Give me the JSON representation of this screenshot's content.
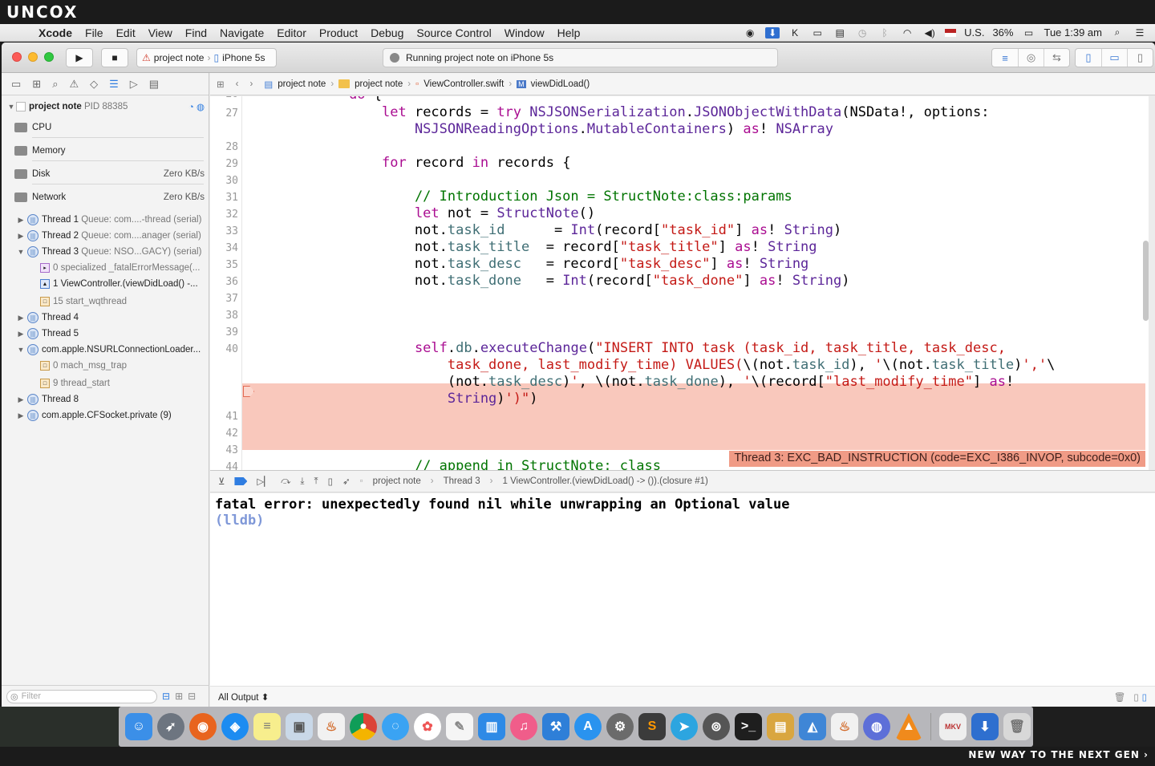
{
  "watermark": "UNCOX",
  "bottom_tag": "NEW WAY TO THE NEXT GEN ›",
  "menubar": {
    "app": "Xcode",
    "items": [
      "File",
      "Edit",
      "View",
      "Find",
      "Navigate",
      "Editor",
      "Product",
      "Debug",
      "Source Control",
      "Window",
      "Help"
    ],
    "input_source": "U.S.",
    "battery": "36%",
    "clock": "Tue 1:39 am"
  },
  "toolbar": {
    "scheme_project": "project note",
    "scheme_device": "iPhone 5s",
    "activity": "Running project note on iPhone 5s"
  },
  "navigator": {
    "process_name": "project note",
    "process_pid": "PID 88385",
    "gauges": [
      {
        "label": "CPU",
        "value": ""
      },
      {
        "label": "Memory",
        "value": ""
      },
      {
        "label": "Disk",
        "value": "Zero KB/s"
      },
      {
        "label": "Network",
        "value": "Zero KB/s"
      }
    ],
    "threads": [
      {
        "name": "Thread 1",
        "detail": "Queue: com....-thread (serial)"
      },
      {
        "name": "Thread 2",
        "detail": "Queue: com....anager (serial)"
      },
      {
        "name": "Thread 3",
        "detail": "Queue: NSO...GACY) (serial)"
      },
      {
        "frame": "0 specialized _fatalErrorMessage(..."
      },
      {
        "frame": "1 ViewController.(viewDidLoad() -..."
      },
      {
        "frame": "15 start_wqthread"
      },
      {
        "name": "Thread 4",
        "detail": ""
      },
      {
        "name": "Thread 5",
        "detail": ""
      },
      {
        "name": "com.apple.NSURLConnectionLoader...",
        "detail": ""
      },
      {
        "frame": "0 mach_msg_trap"
      },
      {
        "frame": "9 thread_start"
      },
      {
        "name": "Thread 8",
        "detail": ""
      },
      {
        "name": "com.apple.CFSocket.private (9)",
        "detail": ""
      }
    ],
    "filter_placeholder": "Filter"
  },
  "jumpbar": {
    "crumbs": [
      "project note",
      "project note",
      "ViewController.swift",
      "viewDidLoad()"
    ]
  },
  "editor": {
    "error_message": "Thread 3: EXC_BAD_INSTRUCTION (code=EXC_I386_INVOP, subcode=0x0)"
  },
  "debugbar": {
    "crumbs": [
      "project note",
      "Thread 3",
      "1 ViewController.(viewDidLoad() -> ()).(closure #1)"
    ]
  },
  "console": {
    "fatal_line": "fatal error: unexpectedly found nil while unwrapping an Optional value",
    "prompt": "(lldb)",
    "output_selector": "All Output ⬍"
  },
  "dock": {
    "apps": [
      "finder-icon",
      "launchpad-icon",
      "firefox-icon",
      "safari-icon",
      "notes-icon",
      "preview-icon",
      "java-icon",
      "chrome-icon",
      "messages-icon",
      "photos-icon",
      "textedit-icon",
      "keynote-icon",
      "itunes-icon",
      "xcode-icon",
      "app-store-icon",
      "system-preferences-icon",
      "sublime-icon",
      "telegram-icon",
      "sequel-icon",
      "terminal-icon",
      "archive-icon",
      "xcode-instruments-icon",
      "java-2-icon",
      "network-icon",
      "vlc-icon",
      "mkv-icon",
      "downloads-icon",
      "trash-icon"
    ]
  }
}
